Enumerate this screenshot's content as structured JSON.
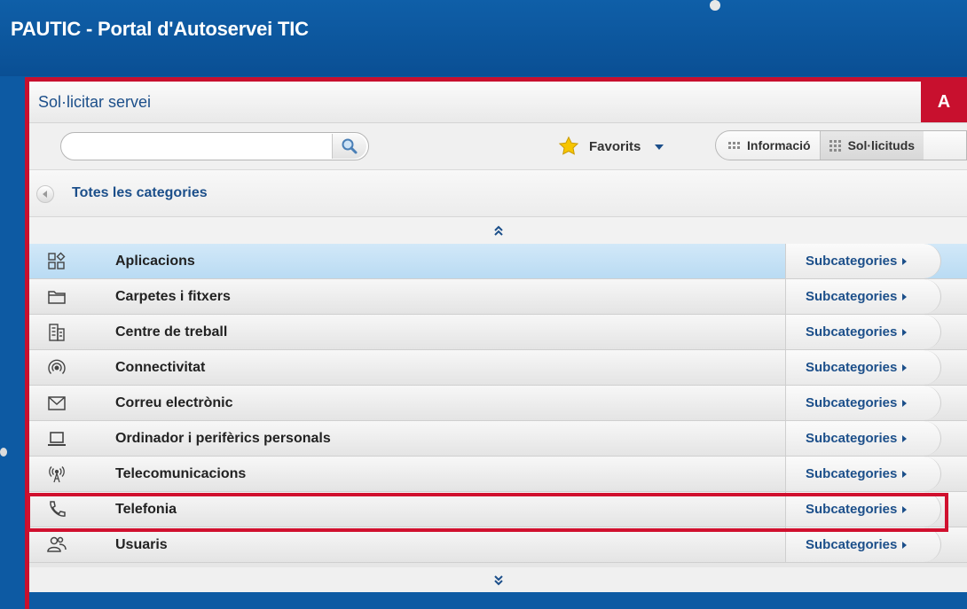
{
  "app": {
    "title": "PAUTIC - Portal d'Autoservei TIC"
  },
  "panel": {
    "title": "Sol·licitar servei",
    "badge": "A"
  },
  "toolbar": {
    "search": {
      "value": "",
      "placeholder": ""
    },
    "favorites_label": "Favorits",
    "view_info_label": "Informació",
    "view_requests_label": "Sol·licituds"
  },
  "breadcrumb": {
    "label": "Totes les categories"
  },
  "categories": [
    {
      "label": "Aplicacions",
      "sub": "Subcategories",
      "icon": "apps-grid-icon",
      "selected": true
    },
    {
      "label": "Carpetes i fitxers",
      "sub": "Subcategories",
      "icon": "folder-icon"
    },
    {
      "label": "Centre de treball",
      "sub": "Subcategories",
      "icon": "building-icon"
    },
    {
      "label": "Connectivitat",
      "sub": "Subcategories",
      "icon": "signal-icon"
    },
    {
      "label": "Correu electrònic",
      "sub": "Subcategories",
      "icon": "mail-icon"
    },
    {
      "label": "Ordinador i perifèrics personals",
      "sub": "Subcategories",
      "icon": "laptop-icon"
    },
    {
      "label": "Telecomunicacions",
      "sub": "Subcategories",
      "icon": "antenna-icon"
    },
    {
      "label": "Telefonia",
      "sub": "Subcategories",
      "icon": "phone-icon",
      "highlighted": true
    },
    {
      "label": "Usuaris",
      "sub": "Subcategories",
      "icon": "users-icon"
    }
  ],
  "colors": {
    "header_blue": "#0d5aa3",
    "highlight_red": "#c8102e",
    "link_blue": "#1c4f8a",
    "selected_row": "#c5e2f6"
  }
}
